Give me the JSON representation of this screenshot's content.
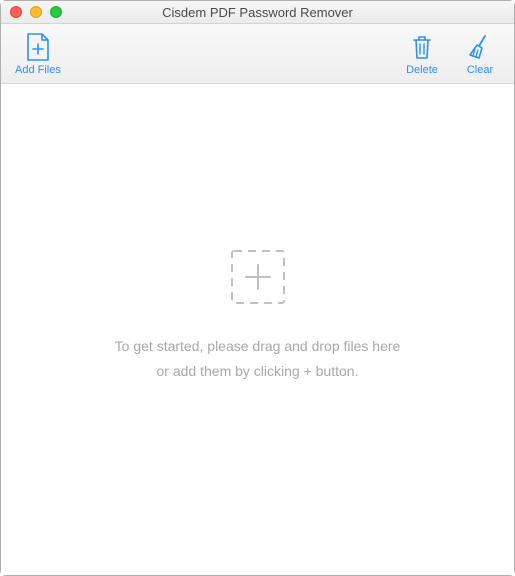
{
  "window": {
    "title": "Cisdem PDF Password Remover"
  },
  "toolbar": {
    "addFiles": "Add Files",
    "delete": "Delete",
    "clear": "Clear"
  },
  "dropzone": {
    "line1": "To get started, please drag and drop files here",
    "line2": "or add them by clicking + button."
  },
  "colors": {
    "accent": "#2a8fff",
    "placeholder": "#c0c0c0",
    "text_muted": "#a8a8a8"
  }
}
